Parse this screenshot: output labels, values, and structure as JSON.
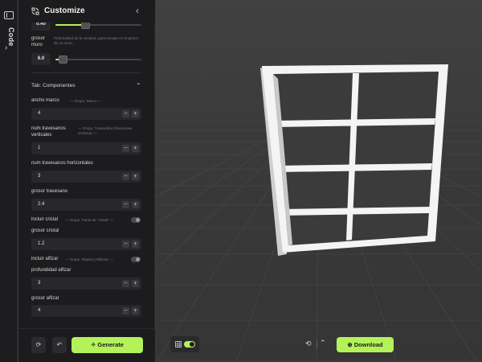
{
  "rail": {
    "label": "Code"
  },
  "panel": {
    "title": "Customize",
    "top_slider": {
      "value": "0.40"
    },
    "grosor_muro": {
      "label": "grosor muro",
      "hint": "Profundidad de la ventana, para encajar en el grosor de un muro.",
      "value": "6.0"
    },
    "section": {
      "title": "Tab: Componentes"
    },
    "fields": [
      {
        "label": "ancho marco",
        "hint": "— Grupo: Marco —",
        "value": "4"
      },
      {
        "label": "num travesanos verticales",
        "hint": "— Grupo: Travesaños (Divisiones ventana) —",
        "value": "1"
      },
      {
        "label": "num travesanos horizontales",
        "hint": "",
        "value": "3"
      },
      {
        "label": "grosor travesano",
        "hint": "",
        "value": "2.4"
      }
    ],
    "incluir_cristal": {
      "label": "incluir cristal",
      "hint": "— Grupo: Panel de \"cristal\" —"
    },
    "grosor_cristal": {
      "label": "grosor cristal",
      "value": "1.2"
    },
    "incluir_alfeizar": {
      "label": "incluir alfizar",
      "hint": "— Grupo: Repisa (Alféizar) —"
    },
    "profundidad_alfeizar": {
      "label": "profundidad alfizar",
      "value": "3"
    },
    "grosor_alfeizar": {
      "label": "grosor alfizar",
      "value": "4"
    },
    "footer": {
      "generate_label": "Generate"
    }
  },
  "viewport": {
    "download_label": "Download"
  },
  "colors": {
    "accent": "#b4f25a",
    "panel_bg": "#1c1c1e",
    "viewport_bg": "#3a3a3a"
  }
}
